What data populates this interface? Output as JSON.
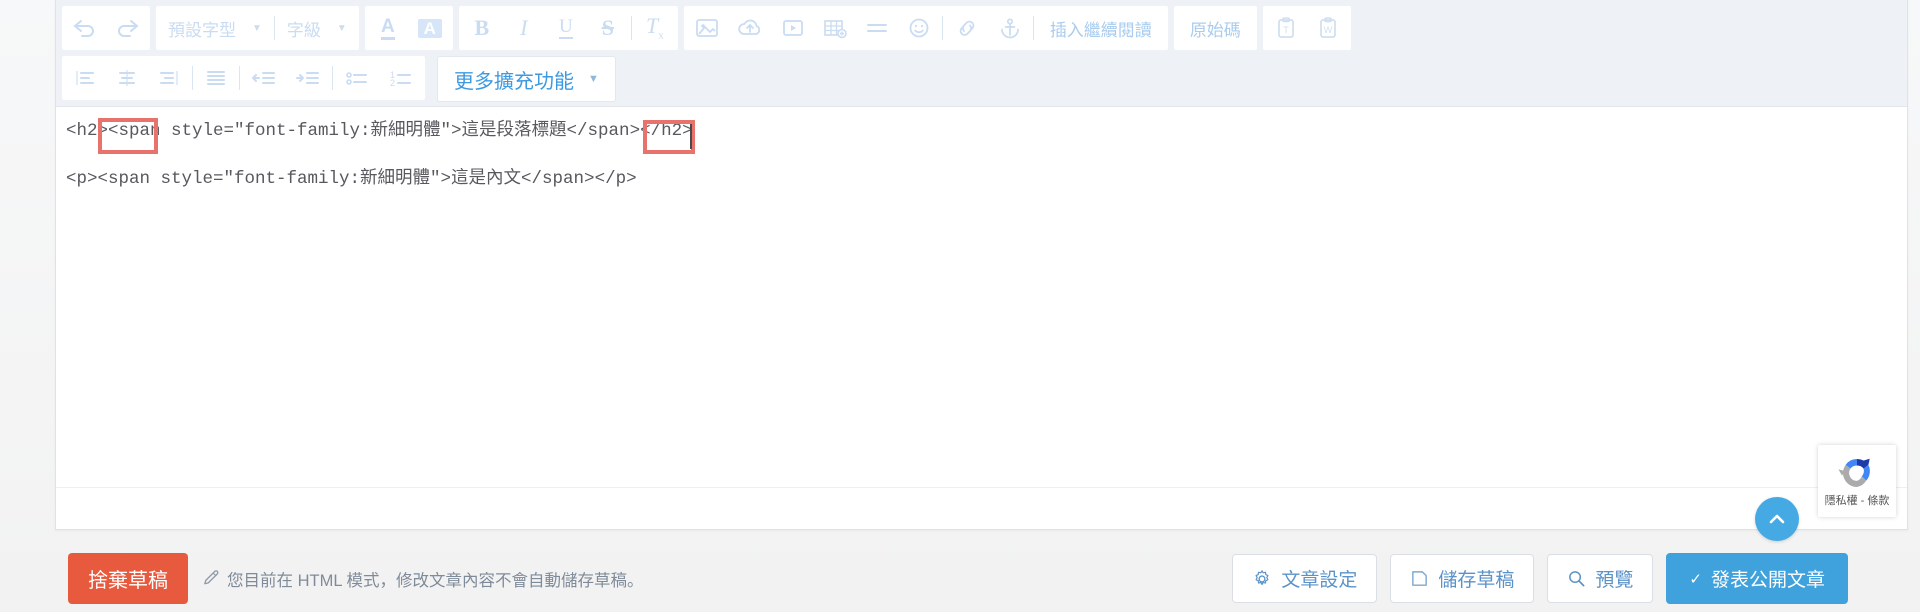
{
  "editor": {
    "toolbar_row1": {
      "undo_label": "undo-arrow",
      "redo_label": "redo-arrow",
      "font_family_select": "預設字型",
      "font_size_select": "字級",
      "text_color": "A",
      "bg_color": "A",
      "bold": "B",
      "italic": "I",
      "underline": "U",
      "strike": "S",
      "clear_format": "Tx",
      "insert_readmore": "插入繼續閱讀",
      "source_code": "原始碼"
    },
    "toolbar_row2": {
      "more_extensions": "更多擴充功能",
      "caret": "▼"
    },
    "code_lines": [
      "<h2><span style=\"font-family:新細明體\">這是段落標題</span></h2>",
      "<p><span style=\"font-family:新細明體\">這是內文</span></p>"
    ],
    "code_line1_prefix": "<h2>",
    "code_line1_middle": "<span style=\"font-family:新細明體\">這是段落標題</span>",
    "code_line1_suffix": "</h2>",
    "highlight_color": "#e8726c"
  },
  "bottom": {
    "discard_label": "捨棄草稿",
    "draft_note": "您目前在 HTML 模式，修改文章內容不會自動儲存草稿。",
    "post_settings": "文章設定",
    "save_draft": "儲存草稿",
    "preview": "預覽",
    "publish": "發表公開文章",
    "publish_check": "✓",
    "primary_color": "#3fa2dd",
    "discard_color": "#e85a3d"
  },
  "overlays": {
    "scroll_top_label": "scroll-to-top",
    "recaptcha_text": "隱私權 - 條款"
  }
}
